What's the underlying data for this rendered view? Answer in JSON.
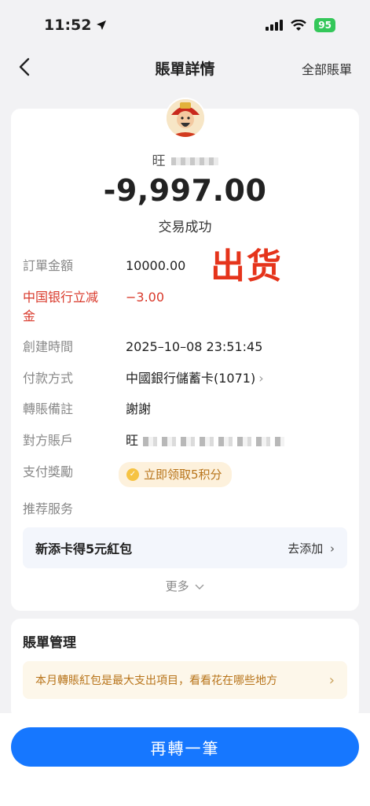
{
  "status_bar": {
    "time": "11:52",
    "battery": "95"
  },
  "nav": {
    "title": "賬單詳情",
    "right_link": "全部賬單"
  },
  "transaction": {
    "merchant_name": "旺",
    "amount": "-9,997.00",
    "status": "交易成功",
    "stamp_text": "出货"
  },
  "details": [
    {
      "label": "訂單金額",
      "value": "10000.00"
    },
    {
      "label": "中国银行立减金",
      "value": "−3.00"
    },
    {
      "label": "創建時間",
      "value": "2025–10–08 23:51:45"
    },
    {
      "label": "付款方式",
      "value": "中國銀行儲蓄卡(1071)"
    },
    {
      "label": "轉賬備註",
      "value": "謝謝"
    },
    {
      "label": "對方賬戶",
      "value": "旺"
    },
    {
      "label": "支付獎勵",
      "value": "立即领取5积分"
    }
  ],
  "recommend": {
    "label": "推荐服务",
    "banner_text": "新添卡得5元紅包",
    "banner_action": "去添加"
  },
  "more_label": "更多",
  "bill_management": {
    "title": "賬單管理",
    "banner_text": "本月轉賬紅包是最大支出項目，看看花在哪些地方"
  },
  "primary_action": "再轉一筆",
  "colors": {
    "accent": "#1677ff",
    "discount_red": "#d9392b",
    "stamp_red": "#e5341b",
    "reward_gold": "#b8741a"
  }
}
